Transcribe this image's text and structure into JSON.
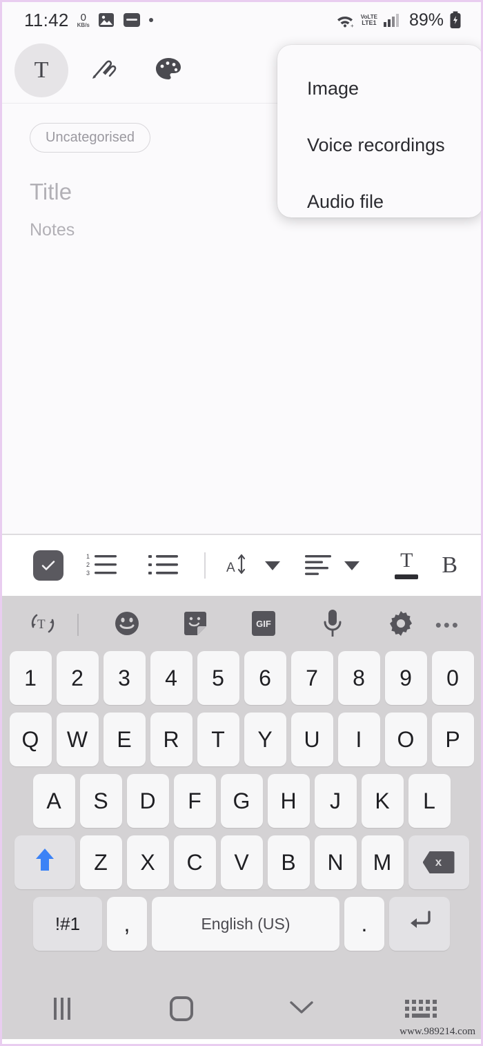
{
  "status_bar": {
    "time": "11:42",
    "network_speed_value": "0",
    "network_speed_unit": "KB/s",
    "icons": [
      "gallery-icon",
      "app-icon",
      "notification-dot"
    ],
    "wifi": "wifi-icon",
    "volte_line1": "VoLTE",
    "volte_line2": "LTE1",
    "signal": "signal-bars-icon",
    "battery_percent": "89%",
    "battery_state": "charging"
  },
  "note_header": {
    "modes": [
      {
        "name": "text-mode",
        "glyph": "T",
        "selected": true
      },
      {
        "name": "handwriting-mode",
        "glyph": "pen-icon",
        "selected": false
      },
      {
        "name": "drawing-mode",
        "glyph": "palette-icon",
        "selected": false
      }
    ]
  },
  "note_body": {
    "category_chip": "Uncategorised",
    "title_placeholder": "Title",
    "notes_placeholder": "Notes"
  },
  "insert_menu": {
    "items": [
      {
        "label": "Image",
        "name": "menu-item-image"
      },
      {
        "label": "Voice recordings",
        "name": "menu-item-voice-recordings"
      },
      {
        "label": "Audio file",
        "name": "menu-item-audio-file"
      }
    ]
  },
  "format_toolbar": {
    "items": [
      {
        "name": "checklist-button",
        "label": "Checklist"
      },
      {
        "name": "numbered-list-button",
        "label": "Numbered list"
      },
      {
        "name": "bulleted-list-button",
        "label": "Bulleted list"
      },
      {
        "name": "font-size-button",
        "label": "Font size"
      },
      {
        "name": "alignment-button",
        "label": "Alignment"
      },
      {
        "name": "text-color-button",
        "label": "Text colour"
      },
      {
        "name": "bold-button",
        "label": "Bold"
      }
    ],
    "bold_glyph": "B",
    "text_color_glyph": "T",
    "font_size_glyph": "A"
  },
  "keyboard": {
    "toolbar": [
      {
        "name": "text-recognition-button",
        "glyph": "T"
      },
      {
        "name": "emoji-button"
      },
      {
        "name": "sticker-button"
      },
      {
        "name": "gif-button",
        "label": "GIF"
      },
      {
        "name": "voice-input-button"
      },
      {
        "name": "keyboard-settings-button"
      },
      {
        "name": "more-options-button",
        "label": "•••"
      }
    ],
    "row_numbers": [
      "1",
      "2",
      "3",
      "4",
      "5",
      "6",
      "7",
      "8",
      "9",
      "0"
    ],
    "row_top": [
      "Q",
      "W",
      "E",
      "R",
      "T",
      "Y",
      "U",
      "I",
      "O",
      "P"
    ],
    "row_home": [
      "A",
      "S",
      "D",
      "F",
      "G",
      "H",
      "J",
      "K",
      "L"
    ],
    "row_bottom": [
      "Z",
      "X",
      "C",
      "V",
      "B",
      "N",
      "M"
    ],
    "shift_state": "active",
    "backspace_label": "x",
    "symbols_key": "!#1",
    "comma_key": ",",
    "space_key": "English (US)",
    "period_key": ".",
    "enter_key": "↵"
  },
  "nav_bar": {
    "recents": "recents-icon",
    "home": "home-icon",
    "hide_keyboard": "chevron-down-icon",
    "keyboard_switch": "keyboard-switch-icon"
  },
  "watermark": "www.989214.com",
  "colors": {
    "frame": "#e9cdf0",
    "keyboard_bg": "#d4d2d4",
    "key_bg": "#f7f7f8",
    "fn_key_bg": "#e3e2e5",
    "shift_active": "#3b82f6",
    "text": "#1f1f23",
    "placeholder": "#b2b0b6"
  }
}
